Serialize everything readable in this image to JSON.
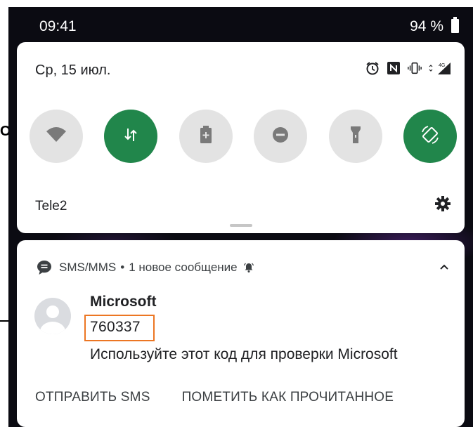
{
  "status_bar": {
    "time": "09:41",
    "battery": "94 %"
  },
  "quick_settings": {
    "date": "Ср, 15 июл.",
    "system_icons": [
      "alarm-icon",
      "nfc-icon",
      "vibrate-icon",
      "signal-4g-icon"
    ],
    "network_type": "4G",
    "tiles": [
      {
        "name": "wifi",
        "icon": "wifi-icon",
        "state": "off"
      },
      {
        "name": "mobile-data",
        "icon": "data-arrows-icon",
        "state": "on"
      },
      {
        "name": "battery-saver",
        "icon": "battery-saver-icon",
        "state": "off"
      },
      {
        "name": "do-not-disturb",
        "icon": "dnd-icon",
        "state": "off"
      },
      {
        "name": "flashlight",
        "icon": "flashlight-icon",
        "state": "off"
      },
      {
        "name": "auto-rotate",
        "icon": "rotate-icon",
        "state": "on"
      }
    ],
    "carrier": "Tele2",
    "accent_on": "#21864b",
    "tile_off": "#e3e3e3"
  },
  "notification": {
    "app_name": "SMS/MMS",
    "separator": "•",
    "summary": "1 новое сообщение",
    "sender": "Microsoft",
    "code": "760337",
    "message": "Используйте этот код для проверки Microsoft",
    "highlight_color": "#ec7623",
    "actions": [
      "ОТПРАВИТЬ SMS",
      "ПОМЕТИТЬ КАК ПРОЧИТАННОЕ"
    ]
  },
  "background_fragment": {
    "left_text": "O"
  }
}
